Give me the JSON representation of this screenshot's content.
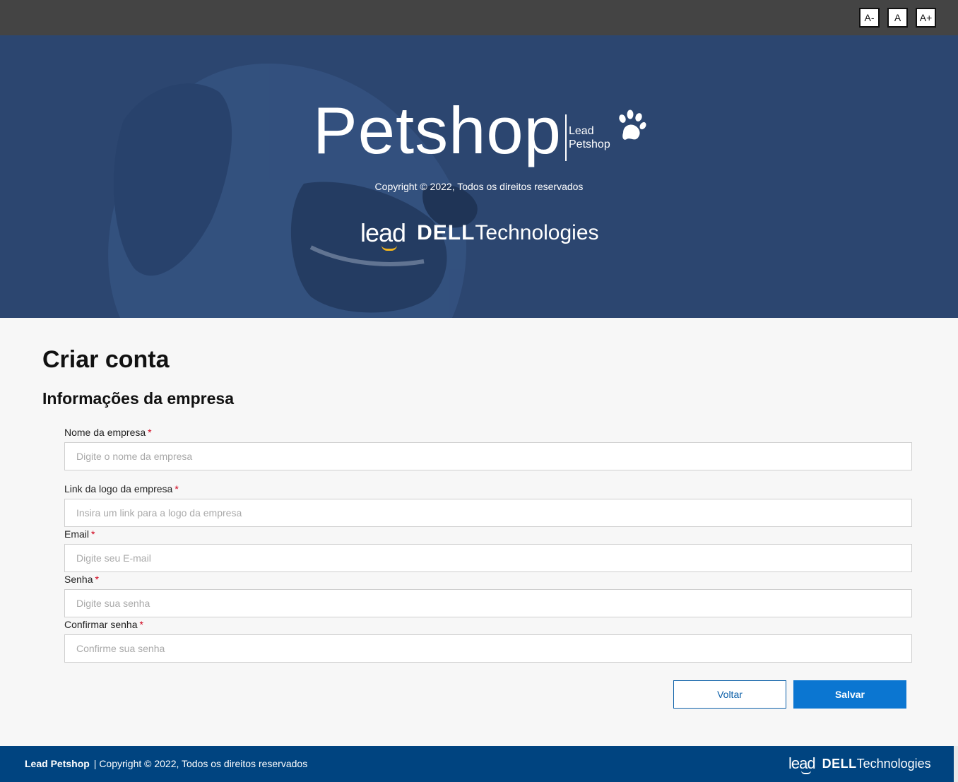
{
  "accessibility": {
    "decrease_label": "A-",
    "normal_label": "A",
    "increase_label": "A+"
  },
  "hero": {
    "title": "Petshop",
    "subtitle_line1": "Lead",
    "subtitle_line2": "Petshop",
    "copyright": "Copyright © 2022, Todos os direitos reservados",
    "logo_lead": "lead",
    "logo_dell": "DELL",
    "logo_technologies": "Technologies",
    "icon": "paw-icon"
  },
  "form": {
    "page_title": "Criar conta",
    "section_title": "Informações da empresa",
    "required_mark": "*",
    "fields": [
      {
        "label": "Nome da empresa",
        "placeholder": "Digite o nome da empresa",
        "value": ""
      },
      {
        "label": "Link da logo da empresa",
        "placeholder": "Insira um link para a logo da empresa",
        "value": ""
      },
      {
        "label": "Email",
        "placeholder": "Digite seu E-mail",
        "value": ""
      },
      {
        "label": "Senha",
        "placeholder": "Digite sua senha",
        "value": ""
      },
      {
        "label": "Confirmar senha",
        "placeholder": "Confirme sua senha",
        "value": ""
      }
    ],
    "back_label": "Voltar",
    "save_label": "Salvar"
  },
  "footer": {
    "brand": "Lead Petshop",
    "copyright": "| Copyright © 2022, Todos os direitos reservados",
    "logo_lead": "lead",
    "logo_dell": "DELL",
    "logo_technologies": "Technologies"
  },
  "colors": {
    "topbar": "#444444",
    "hero_bg": "#2c4670",
    "footer_bg": "#004480",
    "primary": "#0b76d1",
    "required": "#d0021b",
    "lead_accent": "#f2b51c"
  }
}
